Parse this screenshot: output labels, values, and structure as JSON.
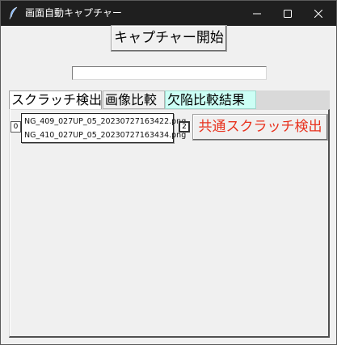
{
  "window": {
    "title": "画面自動キャプチャー",
    "titlebar_color": "#1f1f1f",
    "icons": {
      "app": "feather-pen-icon",
      "minimize": "minimize-icon",
      "maximize": "maximize-icon",
      "close": "close-icon"
    }
  },
  "capture": {
    "button_label": "キャプチャー開始"
  },
  "path_input": {
    "value": "",
    "placeholder": ""
  },
  "tabs": [
    {
      "label": "スクラッチ検出",
      "selected": true,
      "color": "#ffffff"
    },
    {
      "label": "画像比較",
      "selected": false,
      "color": "#f0f0f0"
    },
    {
      "label": "欠陥比較結果",
      "selected": false,
      "color": "#ccfff5"
    }
  ],
  "scratch_tab": {
    "left_spin_value": "0",
    "right_spin_value": "2",
    "files": [
      "NG_409_027UP_05_20230727163422.png",
      "NG_410_027UP_05_20230727163434.png"
    ],
    "common_button_label": "共通スクラッチ検出",
    "common_button_color": "#e8321e"
  }
}
